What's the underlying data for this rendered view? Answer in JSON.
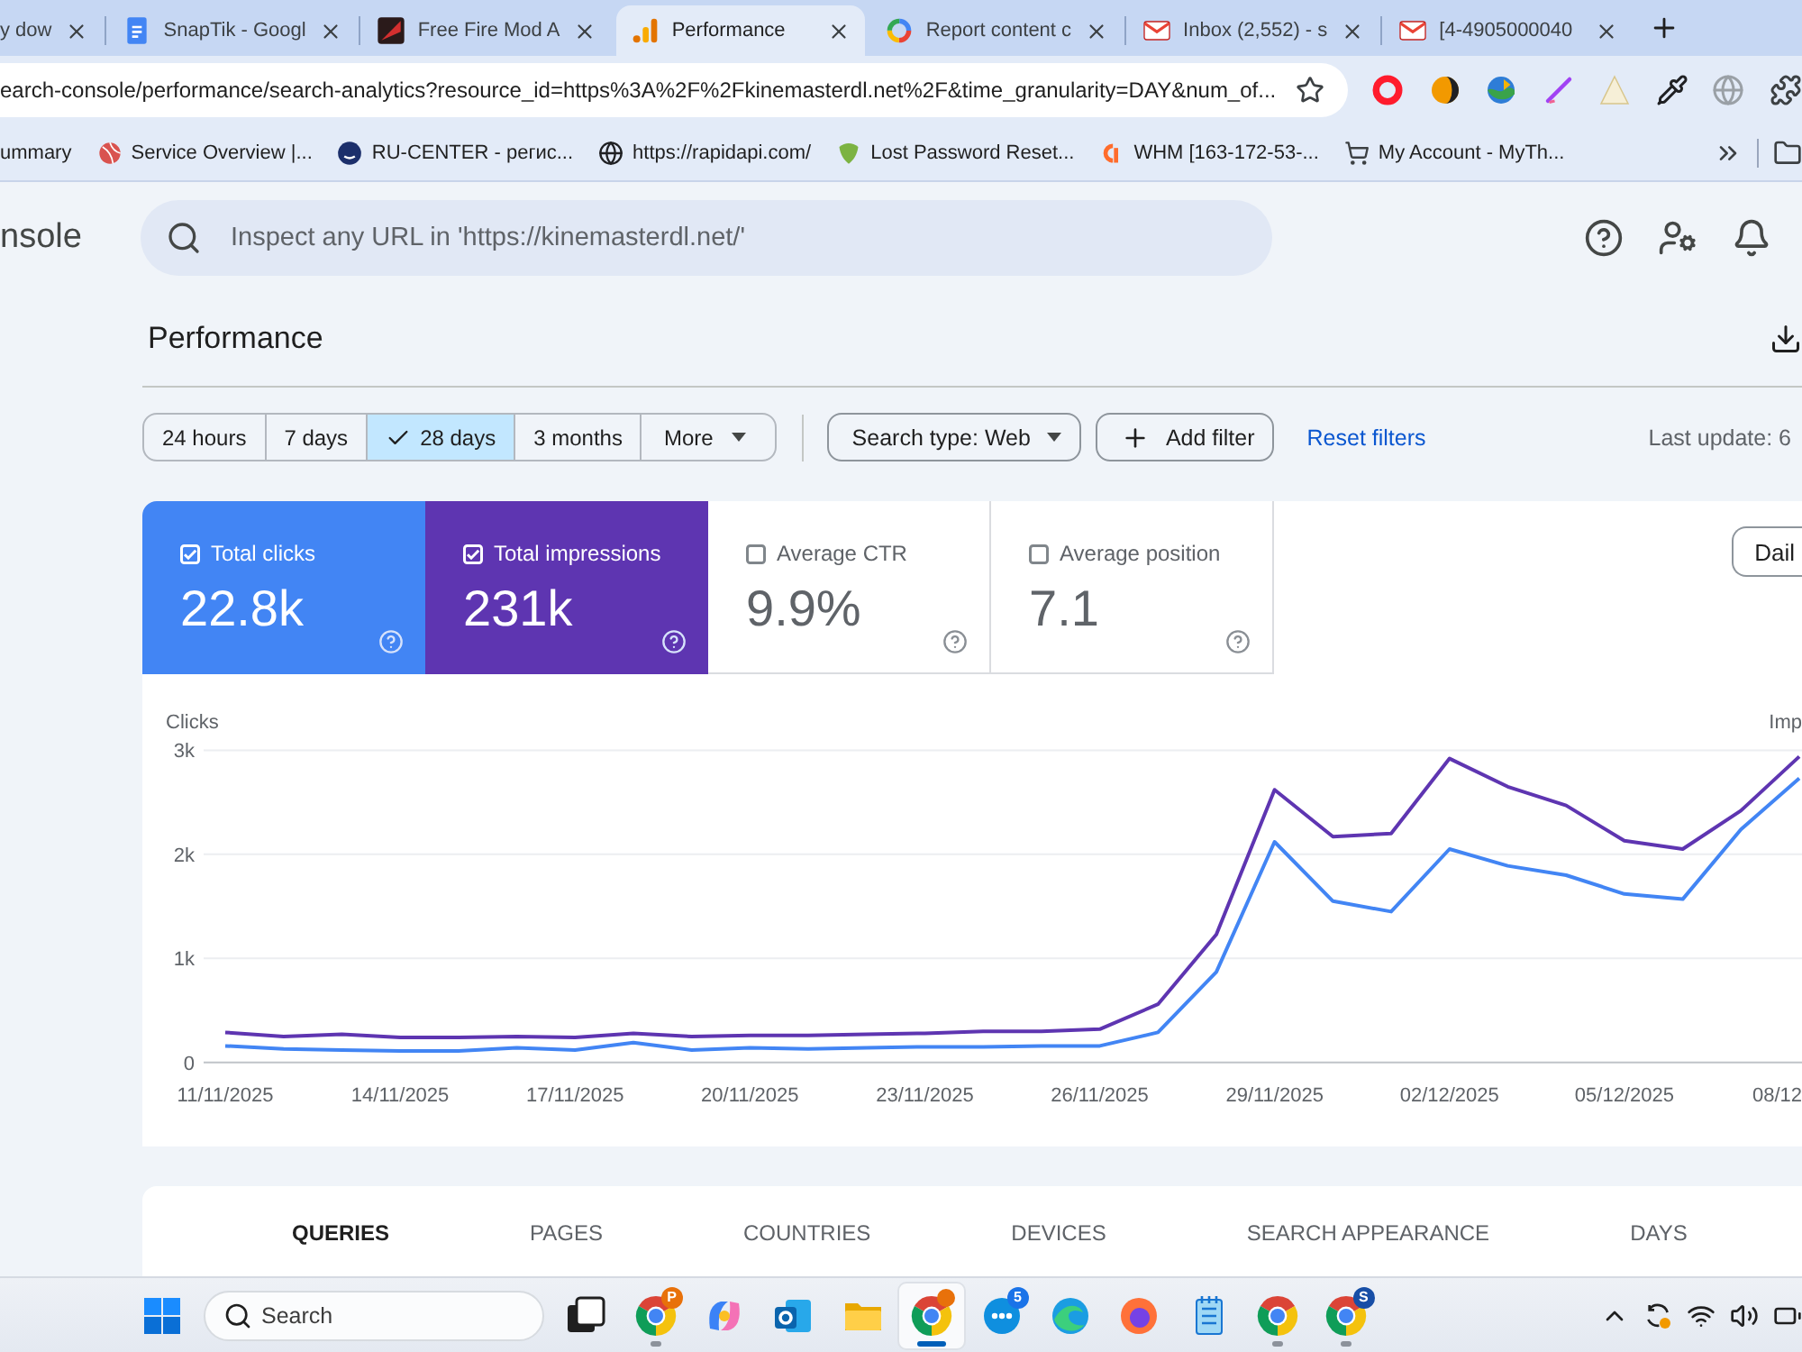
{
  "browser": {
    "tabs": [
      {
        "title": "y dow",
        "selected": false
      },
      {
        "title": "SnapTik - Googl",
        "selected": false
      },
      {
        "title": "Free Fire Mod A",
        "selected": false
      },
      {
        "title": "Performance",
        "selected": true
      },
      {
        "title": "Report content c",
        "selected": false
      },
      {
        "title": "Inbox (2,552) - s",
        "selected": false
      },
      {
        "title": "[4-4905000040",
        "selected": false
      }
    ],
    "address": "earch-console/performance/search-analytics?resource_id=https%3A%2F%2Fkinemasterdl.net%2F&time_granularity=DAY&num_of...",
    "bookmarks": [
      "ummary",
      "Service Overview |...",
      "RU-CENTER - регис...",
      "https://rapidapi.com/",
      "Lost Password Reset...",
      "WHM [163-172-53-...",
      "My Account - MyTh..."
    ]
  },
  "console": {
    "app_title": "nsole",
    "search": {
      "placeholder": "Inspect any URL in 'https://kinemasterdl.net/'"
    },
    "page_title": "Performance"
  },
  "date_ranges": [
    {
      "label": "24 hours",
      "selected": false
    },
    {
      "label": "7 days",
      "selected": false
    },
    {
      "label": "28 days",
      "selected": true
    },
    {
      "label": "3 months",
      "selected": false
    }
  ],
  "more_button": "More",
  "filters": {
    "search_type": "Search type: Web",
    "add_filter": "Add filter",
    "reset": "Reset filters",
    "last_update": "Last update: 6"
  },
  "metrics": [
    {
      "label": "Total clicks",
      "value": "22.8k",
      "checked": true,
      "color": "#4285f4"
    },
    {
      "label": "Total impressions",
      "value": "231k",
      "checked": true,
      "color": "#5e35b1"
    },
    {
      "label": "Average CTR",
      "value": "9.9%",
      "checked": false
    },
    {
      "label": "Average position",
      "value": "7.1",
      "checked": false
    }
  ],
  "granularity_button": "Dail",
  "chart": {
    "right_axis_label": "Imp",
    "edge_tick_label": "08/12",
    "chart_data": {
      "type": "line",
      "ylabel": "Clicks",
      "categories": [
        "11/11/2025",
        null,
        null,
        "14/11/2025",
        null,
        null,
        "17/11/2025",
        null,
        null,
        "20/11/2025",
        null,
        null,
        "23/11/2025",
        null,
        null,
        "26/11/2025",
        null,
        null,
        "29/11/2025",
        null,
        null,
        "02/12/2025",
        null,
        null,
        "05/12/2025",
        null,
        null,
        null
      ],
      "ylim": [
        0,
        3000
      ],
      "yticks": [
        {
          "value": 0,
          "label": "0"
        },
        {
          "value": 1000,
          "label": "1k"
        },
        {
          "value": 2000,
          "label": "2k"
        },
        {
          "value": 3000,
          "label": "3k"
        }
      ],
      "series": [
        {
          "color": "#5e35b1",
          "values": [
            290,
            250,
            270,
            240,
            240,
            250,
            240,
            280,
            250,
            260,
            260,
            270,
            280,
            300,
            300,
            320,
            560,
            1230,
            2620,
            2170,
            2200,
            2920,
            2650,
            2470,
            2130,
            2050,
            2420,
            2940
          ]
        },
        {
          "color": "#4285f4",
          "values": [
            160,
            130,
            120,
            110,
            110,
            140,
            120,
            190,
            120,
            140,
            130,
            140,
            150,
            150,
            160,
            160,
            290,
            870,
            2120,
            1550,
            1450,
            2050,
            1890,
            1800,
            1620,
            1570,
            2240,
            2730
          ]
        }
      ]
    }
  },
  "report_tabs": [
    {
      "label": "QUERIES",
      "selected": true
    },
    {
      "label": "PAGES",
      "selected": false
    },
    {
      "label": "COUNTRIES",
      "selected": false
    },
    {
      "label": "DEVICES",
      "selected": false
    },
    {
      "label": "SEARCH APPEARANCE",
      "selected": false
    },
    {
      "label": "DAYS",
      "selected": false
    }
  ],
  "taskbar": {
    "search": {
      "placeholder": "Search"
    },
    "apps": [
      {
        "running": false,
        "selected": false
      },
      {
        "running": true,
        "selected": false,
        "badge": {
          "text": "P",
          "color": "#e8710a"
        }
      },
      {
        "running": false,
        "selected": false
      },
      {
        "running": false,
        "selected": false
      },
      {
        "running": false,
        "selected": false
      },
      {
        "running": true,
        "selected": true,
        "badge": {
          "color": "#e8710a"
        }
      },
      {
        "running": false,
        "selected": false,
        "badge": {
          "text": "5",
          "color": "#1a73e8"
        }
      },
      {
        "running": false,
        "selected": false
      },
      {
        "running": false,
        "selected": false
      },
      {
        "running": false,
        "selected": false
      },
      {
        "running": true,
        "selected": false
      },
      {
        "running": true,
        "selected": false,
        "badge": {
          "text": "S",
          "color": "#174ea6"
        }
      }
    ]
  }
}
